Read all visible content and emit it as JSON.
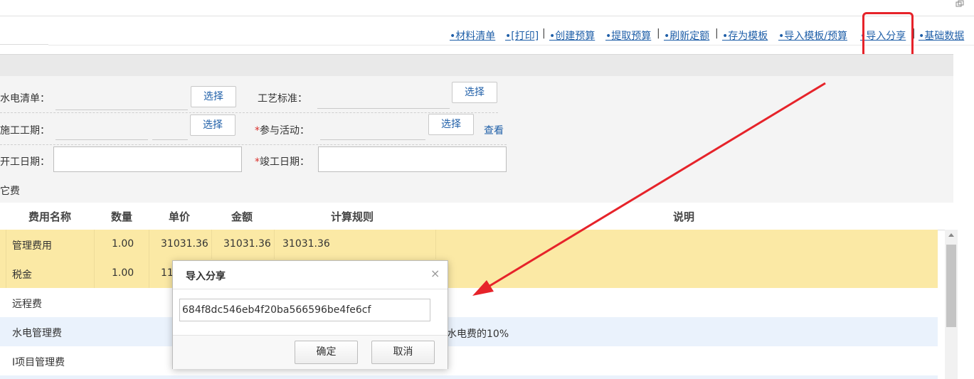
{
  "toolbar": {
    "links": [
      "•材料清单",
      "•[打印]",
      "•创建预算",
      "•提取预算",
      "•刷新定额",
      "•存为模板",
      "•导入模板/预算",
      "•导入分享",
      "•基础数据"
    ],
    "separator": "|"
  },
  "form": {
    "plumbing_list_label": "水电清单：",
    "process_standard_label": "工艺标准：",
    "construction_period_label": "施工工期：",
    "activity_label": "参与活动：",
    "start_date_label": "开工日期：",
    "completion_date_label": "竣工日期：",
    "required_mark": "*",
    "select_label": "选择",
    "view_label": "查看",
    "section_label": "它费"
  },
  "table": {
    "headers": [
      "费用名称",
      "数量",
      "单价",
      "金额",
      "计算规则",
      "说明"
    ],
    "rows": [
      {
        "name": "管理费用",
        "qty": "1.00",
        "price": "31031.36",
        "amount": "31031.36",
        "rule": "31031.36",
        "note": ""
      },
      {
        "name": "税金",
        "qty": "1.00",
        "price": "11",
        "amount": "",
        "rule": "",
        "note": ""
      },
      {
        "name": "远程费",
        "qty": "",
        "price": "",
        "amount": "",
        "rule": "",
        "note": ""
      },
      {
        "name": "水电管理费",
        "qty": "",
        "price": "",
        "amount": "",
        "rule": "",
        "note": "水电费的10%"
      },
      {
        "name": "I项目管理费",
        "qty": "",
        "price": "",
        "amount": "",
        "rule": "",
        "note": ""
      }
    ]
  },
  "dialog": {
    "title": "导入分享",
    "close": "×",
    "input_value": "684f8dc546eb4f20ba566596be4fe6cf",
    "confirm_label": "确定",
    "cancel_label": "取消"
  },
  "colors": {
    "link": "#1f5fa8",
    "highlight": "#e6232a",
    "row_yellow": "#fbe9a5",
    "row_blue": "#eaf2fc"
  }
}
